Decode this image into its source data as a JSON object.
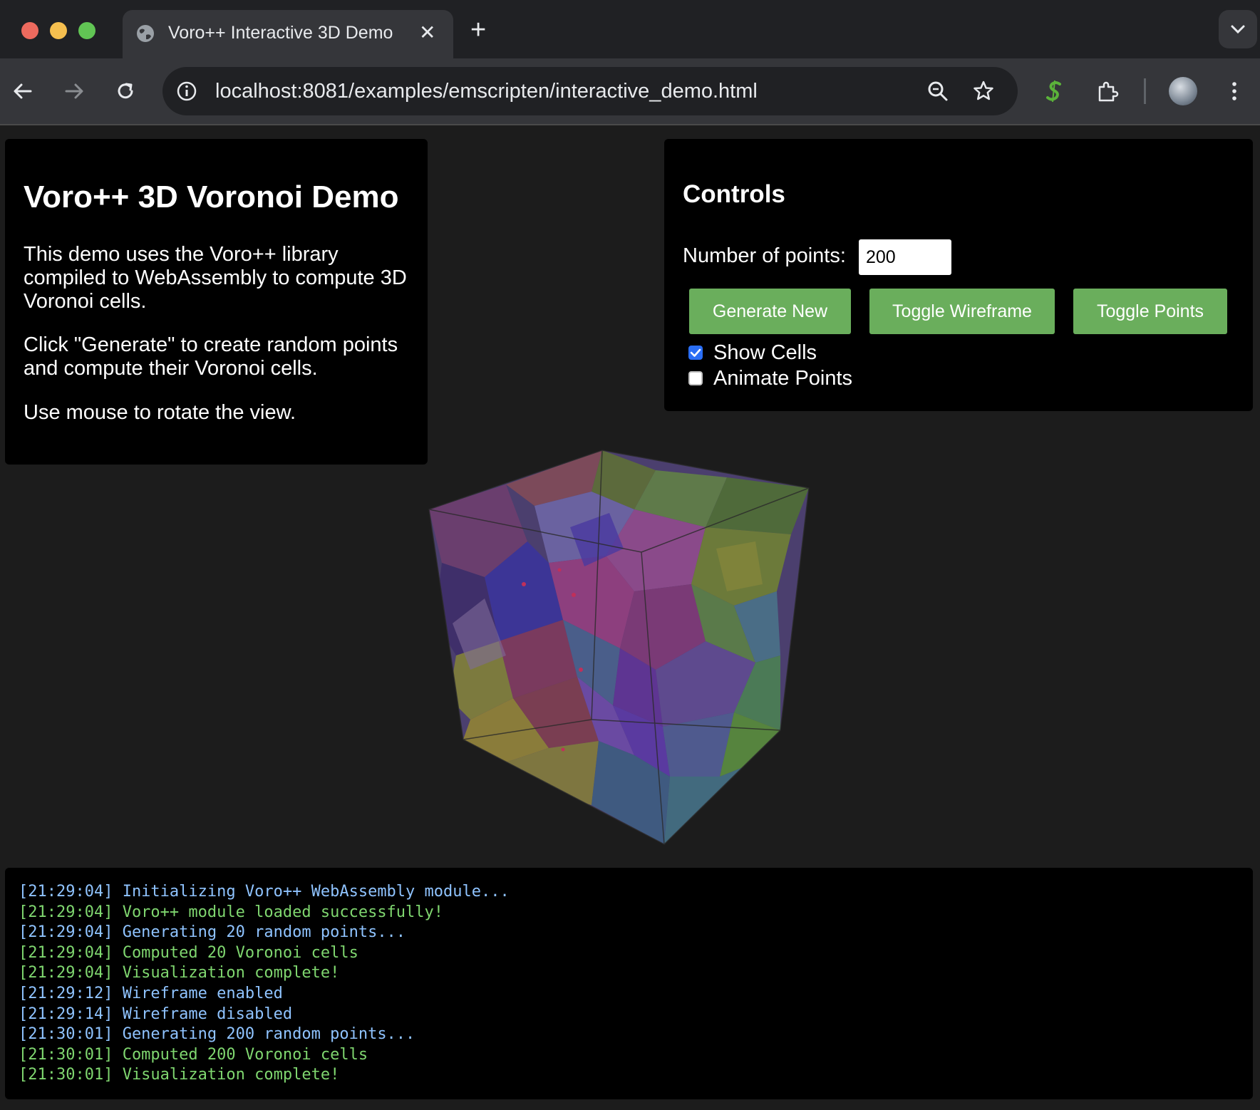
{
  "browser": {
    "tab_title": "Voro++ Interactive 3D Demo",
    "tab_close": "✕",
    "new_tab": "+",
    "url": "localhost:8081/examples/emscripten/interactive_demo.html",
    "icons": [
      "back-icon",
      "forward-icon",
      "reload-icon",
      "site-info-icon",
      "zoom-icon",
      "bookmark-star-icon",
      "extension-s-icon",
      "extensions-puzzle-icon",
      "profile-avatar",
      "menu-icon",
      "tab-list-icon"
    ]
  },
  "info": {
    "title": "Voro++ 3D Voronoi Demo",
    "para1": "This demo uses the Voro++ library compiled to WebAssembly to compute 3D Voronoi cells.",
    "para2": "Click \"Generate\" to create random points and compute their Voronoi cells.",
    "para3": "Use mouse to rotate the view."
  },
  "controls": {
    "title": "Controls",
    "num_points_label": "Number of points:",
    "num_points_value": "200",
    "generate_label": "Generate New",
    "wireframe_label": "Toggle Wireframe",
    "points_label": "Toggle Points",
    "show_cells_label": "Show Cells",
    "show_cells_checked": true,
    "animate_label": "Animate Points",
    "animate_checked": false,
    "button_color": "#6aae5c"
  },
  "log": {
    "info_color": "#8fc3ff",
    "success_color": "#7fd66f",
    "lines": [
      {
        "text": "[21:29:04] Initializing Voro++ WebAssembly module...",
        "kind": "info"
      },
      {
        "text": "[21:29:04] Voro++ module loaded successfully!",
        "kind": "success"
      },
      {
        "text": "[21:29:04] Generating 20 random points...",
        "kind": "info"
      },
      {
        "text": "[21:29:04] Computed 20 Voronoi cells",
        "kind": "success"
      },
      {
        "text": "[21:29:04] Visualization complete!",
        "kind": "success"
      },
      {
        "text": "[21:29:12] Wireframe enabled",
        "kind": "info"
      },
      {
        "text": "[21:29:14] Wireframe disabled",
        "kind": "info"
      },
      {
        "text": "[21:30:01] Generating 200 random points...",
        "kind": "info"
      },
      {
        "text": "[21:30:01] Computed 200 Voronoi cells",
        "kind": "success"
      },
      {
        "text": "[21:30:01] Visualization complete!",
        "kind": "success"
      }
    ]
  }
}
